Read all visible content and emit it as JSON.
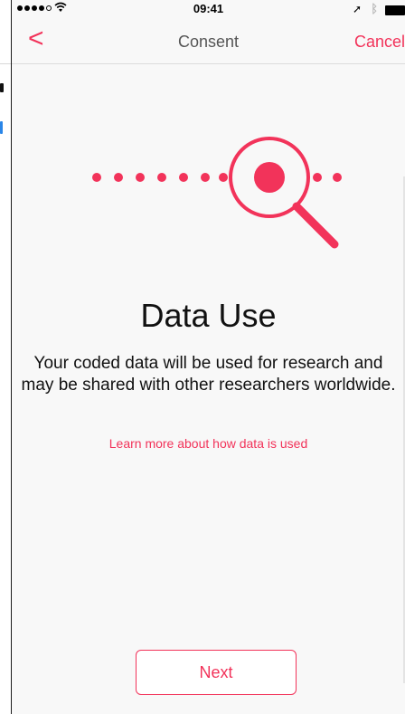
{
  "status_bar": {
    "time": "09:41"
  },
  "nav": {
    "back_symbol": "<",
    "title": "Consent",
    "cancel_label": "Cancel"
  },
  "content": {
    "heading": "Data Use",
    "body": "Your coded data will be used for research and may be shared with other researchers worldwide.",
    "learn_more": "Learn more about how data is used"
  },
  "footer": {
    "next_label": "Next"
  },
  "colors": {
    "accent": "#f2335a",
    "background": "#f8f8f8",
    "text": "#111111"
  },
  "icons": [
    "signal-icon",
    "wifi-icon",
    "location-icon",
    "bluetooth-icon",
    "battery-icon",
    "back-chevron-icon",
    "data-search-icon"
  ]
}
